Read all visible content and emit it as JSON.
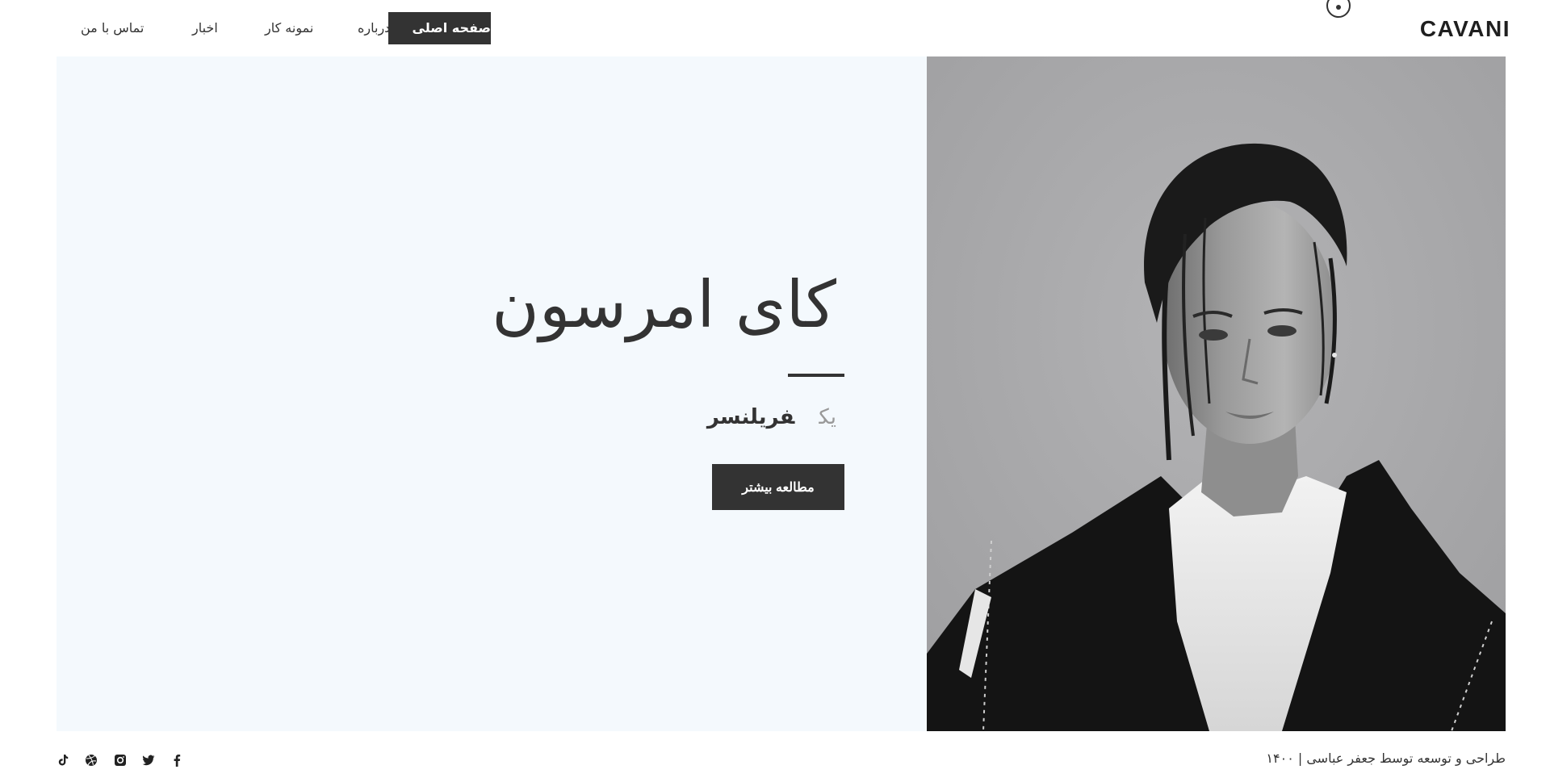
{
  "header": {
    "logo": "CAVANI",
    "nav": [
      {
        "key": "home",
        "label": "صفحه اصلی",
        "active": true
      },
      {
        "key": "about",
        "label": "درباره",
        "active": false
      },
      {
        "key": "portfolio",
        "label": "نمونه کار",
        "active": false
      },
      {
        "key": "news",
        "label": "اخبار",
        "active": false
      },
      {
        "key": "contact",
        "label": "تماس با من",
        "active": false
      }
    ]
  },
  "hero": {
    "name": "کای امرسون",
    "subtitle_prefix": "یک",
    "subtitle_role": "فریلنسر",
    "cta_label": "مطالعه بیشتر"
  },
  "footer": {
    "copyright": "طراحی و توسعه توسط جعفر عباسی | ۱۴۰۰",
    "social": [
      "facebook-icon",
      "twitter-icon",
      "instagram-icon",
      "dribbble-icon",
      "tiktok-icon"
    ]
  },
  "colors": {
    "accent": "#333333",
    "hero_bg": "#f4f9fd",
    "photo_bg": "#a9a9ab",
    "muted_text": "#999999"
  }
}
